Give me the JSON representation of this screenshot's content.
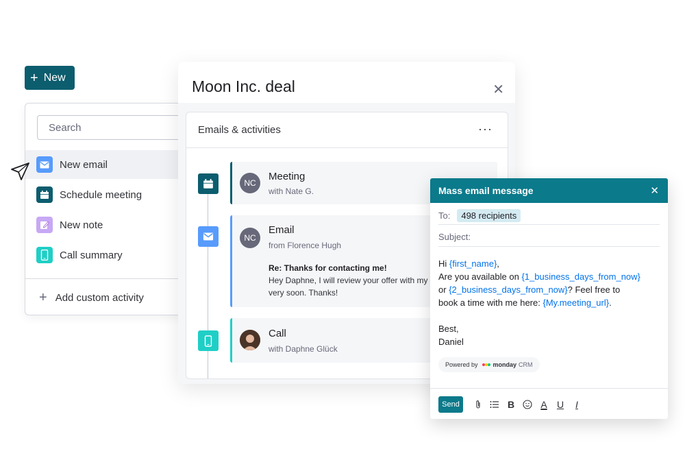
{
  "new_button": {
    "label": "New",
    "icon": "plus-icon"
  },
  "menu": {
    "search_placeholder": "Search",
    "items": [
      {
        "label": "New email",
        "icon": "email-icon",
        "color": "#579bfc"
      },
      {
        "label": "Schedule meeting",
        "icon": "calendar-icon",
        "color": "#0c5d6e"
      },
      {
        "label": "New note",
        "icon": "note-icon",
        "color": "#a25ddc"
      },
      {
        "label": "Call summary",
        "icon": "phone-icon",
        "color": "#1fcfc6"
      }
    ],
    "add_custom": "Add custom activity"
  },
  "deal": {
    "title": "Moon Inc. deal",
    "section_title": "Emails & activities",
    "activities": [
      {
        "type": "Meeting",
        "avatar": "NC",
        "sub": "with Nate G."
      },
      {
        "type": "Email",
        "avatar": "NC",
        "sub": "from Florence Hugh",
        "body_title": "Re: Thanks for contacting me!",
        "body": "Hey Daphne, I will review your offer with my te contact you very soon. Thanks!"
      },
      {
        "type": "Call",
        "sub": "with Daphne Glück"
      }
    ]
  },
  "mass_email": {
    "title": "Mass email message",
    "to_label": "To:",
    "recipients": "498 recipients",
    "subject_label": "Subject:",
    "message": {
      "hi": "Hi",
      "first_name": "{first_name}",
      "line2_pre": "Are you available on",
      "day1": "{1_business_days_from_now}",
      "line3_pre": "or",
      "day2": "{2_business_days_from_now}",
      "line3_post": "? Feel free to",
      "line4_pre": "book a time with me here:",
      "url": "{My.meeting_url}",
      "sign1": "Best,",
      "sign2": "Daniel"
    },
    "powered_by": "Powered by",
    "brand": "monday",
    "brand_suffix": "CRM",
    "send_label": "Send"
  },
  "colors": {
    "brand_dark": "#0c5d6e",
    "mass_header": "#0b7a8b",
    "variable": "#0073ea"
  }
}
